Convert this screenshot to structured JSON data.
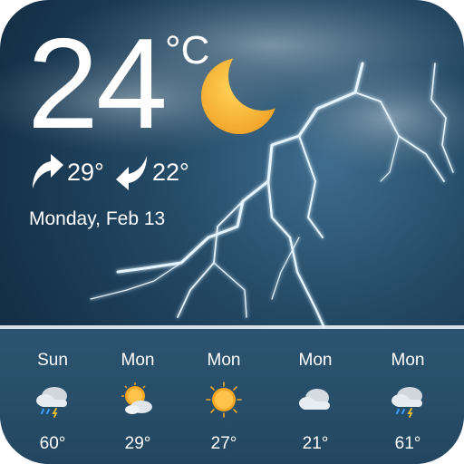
{
  "current": {
    "temperature": "24",
    "unit": "°C",
    "condition_icon": "crescent-moon-icon",
    "high": "29°",
    "low": "22°",
    "date": "Monday, Feb 13"
  },
  "forecast": [
    {
      "day": "Sun",
      "temp": "60°",
      "icon": "cloud-rain-thunder-icon"
    },
    {
      "day": "Mon",
      "temp": "29°",
      "icon": "partly-cloudy-sun-icon"
    },
    {
      "day": "Mon",
      "temp": "27°",
      "icon": "sun-icon"
    },
    {
      "day": "Mon",
      "temp": "21°",
      "icon": "cloud-icon"
    },
    {
      "day": "Mon",
      "temp": "61°",
      "icon": "cloud-rain-thunder-icon"
    }
  ],
  "colors": {
    "background_dark": "#16334b",
    "moon": "#f6b533",
    "sun": "#f7a823",
    "lightning": "#dff3ff"
  }
}
